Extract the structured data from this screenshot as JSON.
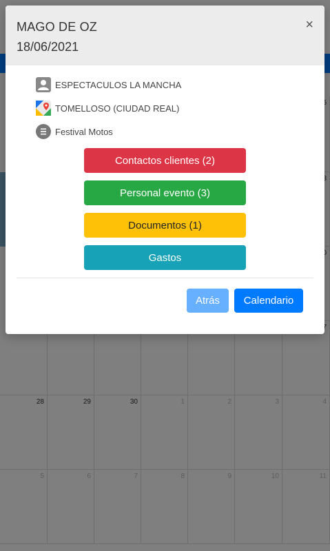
{
  "modal": {
    "title": "MAGO DE OZ",
    "date": "18/06/2021",
    "close_label": "×",
    "info": [
      {
        "icon": "person-icon",
        "text": "ESPECTACULOS LA MANCHA"
      },
      {
        "icon": "map-pin-icon",
        "text": "TOMELLOSO (CIUDAD REAL)"
      },
      {
        "icon": "list-icon",
        "text": "Festival Motos"
      }
    ],
    "buttons": {
      "contactos": "Contactos clientes (2)",
      "personal": "Personal evento (3)",
      "documentos": "Documentos (1)",
      "gastos": "Gastos"
    },
    "footer": {
      "back_label": "Atrás",
      "calendar_label": "Calendario"
    }
  },
  "calendar": {
    "visible_day_numbers": {
      "row_right_partial": [
        "6",
        "3",
        "0",
        "7"
      ],
      "row5": [
        "28",
        "29",
        "30",
        "1",
        "2",
        "3",
        "4"
      ],
      "row6": [
        "5",
        "6",
        "7",
        "8",
        "9",
        "10",
        "11"
      ]
    }
  },
  "colors": {
    "red": "#dc3545",
    "green": "#28a745",
    "yellow": "#ffc107",
    "teal": "#17a2b8",
    "primary": "#007bff",
    "primary_light": "#66b0ff"
  }
}
